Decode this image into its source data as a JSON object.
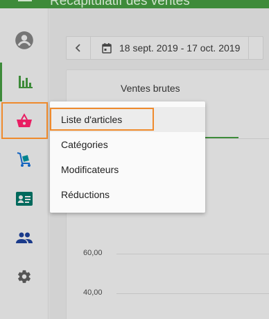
{
  "header": {
    "title": "Récapitulatif des ventes"
  },
  "sidebar": {
    "items": [
      {
        "icon": "account-circle-icon"
      },
      {
        "icon": "bar-chart-icon"
      },
      {
        "icon": "basket-icon"
      },
      {
        "icon": "inventory-cart-icon"
      },
      {
        "icon": "badge-card-icon"
      },
      {
        "icon": "people-icon"
      },
      {
        "icon": "gear-icon"
      }
    ]
  },
  "date_picker": {
    "range": "18 sept. 2019 - 17 oct. 2019"
  },
  "card": {
    "tab_label": "Ventes brutes"
  },
  "chart": {
    "y_ticks": [
      "60,00",
      "40,00"
    ]
  },
  "dropdown": {
    "items": [
      "Liste d'articles",
      "Catégories",
      "Modificateurs",
      "Réductions"
    ]
  },
  "colors": {
    "brand_green": "#3e8b3a",
    "basket_pink": "#e91e63",
    "nav_icon_blue": "#1565c0",
    "nav_icon_teal": "#00695c",
    "highlight_orange": "#ef8a2c"
  }
}
